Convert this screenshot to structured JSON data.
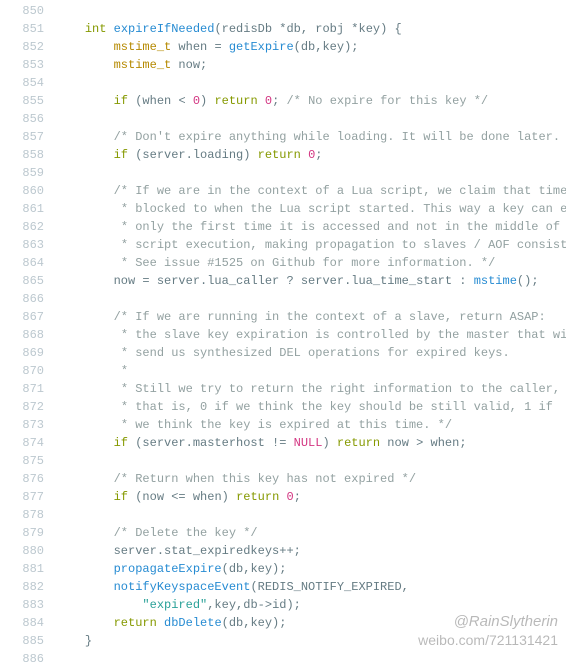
{
  "startLine": 850,
  "watermark": {
    "handle": "@RainSlytherin",
    "url": "weibo.com/721131421"
  },
  "lines": [
    [],
    [
      [
        "sp",
        "    "
      ],
      [
        "kw",
        "int"
      ],
      [
        "op",
        " "
      ],
      [
        "fn",
        "expireIfNeeded"
      ],
      [
        "op",
        "(redisDb "
      ],
      [
        "op",
        "*"
      ],
      [
        "id",
        "db"
      ],
      [
        "op",
        ", robj "
      ],
      [
        "op",
        "*"
      ],
      [
        "id",
        "key"
      ],
      [
        "op",
        ") {"
      ]
    ],
    [
      [
        "sp",
        "        "
      ],
      [
        "type",
        "mstime_t"
      ],
      [
        "op",
        " when "
      ],
      [
        "op",
        "="
      ],
      [
        "op",
        " "
      ],
      [
        "fn",
        "getExpire"
      ],
      [
        "op",
        "(db,key);"
      ]
    ],
    [
      [
        "sp",
        "        "
      ],
      [
        "type",
        "mstime_t"
      ],
      [
        "op",
        " now;"
      ]
    ],
    [],
    [
      [
        "sp",
        "        "
      ],
      [
        "kw",
        "if"
      ],
      [
        "op",
        " (when "
      ],
      [
        "op",
        "<"
      ],
      [
        "op",
        " "
      ],
      [
        "num",
        "0"
      ],
      [
        "op",
        ") "
      ],
      [
        "kw",
        "return"
      ],
      [
        "op",
        " "
      ],
      [
        "num",
        "0"
      ],
      [
        "op",
        "; "
      ],
      [
        "cm",
        "/* No expire for this key */"
      ]
    ],
    [],
    [
      [
        "sp",
        "        "
      ],
      [
        "cm",
        "/* Don't expire anything while loading. It will be done later. */"
      ]
    ],
    [
      [
        "sp",
        "        "
      ],
      [
        "kw",
        "if"
      ],
      [
        "op",
        " (server.loading) "
      ],
      [
        "kw",
        "return"
      ],
      [
        "op",
        " "
      ],
      [
        "num",
        "0"
      ],
      [
        "op",
        ";"
      ]
    ],
    [],
    [
      [
        "sp",
        "        "
      ],
      [
        "cm",
        "/* If we are in the context of a Lua script, we claim that time is"
      ]
    ],
    [
      [
        "sp",
        "         "
      ],
      [
        "cm",
        "* blocked to when the Lua script started. This way a key can expire"
      ]
    ],
    [
      [
        "sp",
        "         "
      ],
      [
        "cm",
        "* only the first time it is accessed and not in the middle of the"
      ]
    ],
    [
      [
        "sp",
        "         "
      ],
      [
        "cm",
        "* script execution, making propagation to slaves / AOF consistent."
      ]
    ],
    [
      [
        "sp",
        "         "
      ],
      [
        "cm",
        "* See issue #1525 on Github for more information. */"
      ]
    ],
    [
      [
        "sp",
        "        "
      ],
      [
        "id",
        "now "
      ],
      [
        "op",
        "="
      ],
      [
        "op",
        " server.lua_caller "
      ],
      [
        "op",
        "?"
      ],
      [
        "op",
        " server.lua_time_start "
      ],
      [
        "op",
        ":"
      ],
      [
        "op",
        " "
      ],
      [
        "fn",
        "mstime"
      ],
      [
        "op",
        "();"
      ]
    ],
    [],
    [
      [
        "sp",
        "        "
      ],
      [
        "cm",
        "/* If we are running in the context of a slave, return ASAP:"
      ]
    ],
    [
      [
        "sp",
        "         "
      ],
      [
        "cm",
        "* the slave key expiration is controlled by the master that will"
      ]
    ],
    [
      [
        "sp",
        "         "
      ],
      [
        "cm",
        "* send us synthesized DEL operations for expired keys."
      ]
    ],
    [
      [
        "sp",
        "         "
      ],
      [
        "cm",
        "*"
      ]
    ],
    [
      [
        "sp",
        "         "
      ],
      [
        "cm",
        "* Still we try to return the right information to the caller,"
      ]
    ],
    [
      [
        "sp",
        "         "
      ],
      [
        "cm",
        "* that is, 0 if we think the key should be still valid, 1 if"
      ]
    ],
    [
      [
        "sp",
        "         "
      ],
      [
        "cm",
        "* we think the key is expired at this time. */"
      ]
    ],
    [
      [
        "sp",
        "        "
      ],
      [
        "kw",
        "if"
      ],
      [
        "op",
        " (server.masterhost "
      ],
      [
        "op",
        "!="
      ],
      [
        "op",
        " "
      ],
      [
        "num",
        "NULL"
      ],
      [
        "op",
        ") "
      ],
      [
        "kw",
        "return"
      ],
      [
        "op",
        " now "
      ],
      [
        "op",
        ">"
      ],
      [
        "op",
        " when;"
      ]
    ],
    [],
    [
      [
        "sp",
        "        "
      ],
      [
        "cm",
        "/* Return when this key has not expired */"
      ]
    ],
    [
      [
        "sp",
        "        "
      ],
      [
        "kw",
        "if"
      ],
      [
        "op",
        " (now "
      ],
      [
        "op",
        "<="
      ],
      [
        "op",
        " when) "
      ],
      [
        "kw",
        "return"
      ],
      [
        "op",
        " "
      ],
      [
        "num",
        "0"
      ],
      [
        "op",
        ";"
      ]
    ],
    [],
    [
      [
        "sp",
        "        "
      ],
      [
        "cm",
        "/* Delete the key */"
      ]
    ],
    [
      [
        "sp",
        "        "
      ],
      [
        "id",
        "server.stat_expiredkeys"
      ],
      [
        "op",
        "++"
      ],
      [
        "op",
        ";"
      ]
    ],
    [
      [
        "sp",
        "        "
      ],
      [
        "fn",
        "propagateExpire"
      ],
      [
        "op",
        "(db,key);"
      ]
    ],
    [
      [
        "sp",
        "        "
      ],
      [
        "fn",
        "notifyKeyspaceEvent"
      ],
      [
        "op",
        "(REDIS_NOTIFY_EXPIRED,"
      ]
    ],
    [
      [
        "sp",
        "            "
      ],
      [
        "str",
        "\"expired\""
      ],
      [
        "op",
        ",key,db"
      ],
      [
        "op",
        "->"
      ],
      [
        "id",
        "id"
      ],
      [
        "op",
        ");"
      ]
    ],
    [
      [
        "sp",
        "        "
      ],
      [
        "kw",
        "return"
      ],
      [
        "op",
        " "
      ],
      [
        "fn",
        "dbDelete"
      ],
      [
        "op",
        "(db,key);"
      ]
    ],
    [
      [
        "sp",
        "    "
      ],
      [
        "op",
        "}"
      ]
    ],
    []
  ]
}
